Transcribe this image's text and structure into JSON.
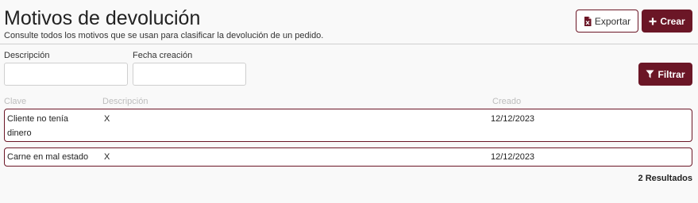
{
  "header": {
    "title": "Motivos de devolución",
    "subtitle": "Consulte todos los motivos que se usan para clasificar la devolución de un pedido.",
    "export_label": "Exportar",
    "create_label": "Crear"
  },
  "filters": {
    "description_label": "Descripción",
    "description_value": "",
    "date_label": "Fecha creación",
    "date_value": "",
    "filter_label": "Filtrar"
  },
  "table": {
    "columns": [
      "Clave",
      "Descripción",
      "Creado"
    ],
    "rows": [
      {
        "clave": "Cliente no tenía dinero",
        "descripcion": "X",
        "creado": "12/12/2023"
      },
      {
        "clave": "Carne en mal estado",
        "descripcion": "X",
        "creado": "12/12/2023"
      }
    ]
  },
  "results_text": "2 Resultados",
  "colors": {
    "accent": "#6b1626",
    "export_icon": "#6b1626"
  }
}
